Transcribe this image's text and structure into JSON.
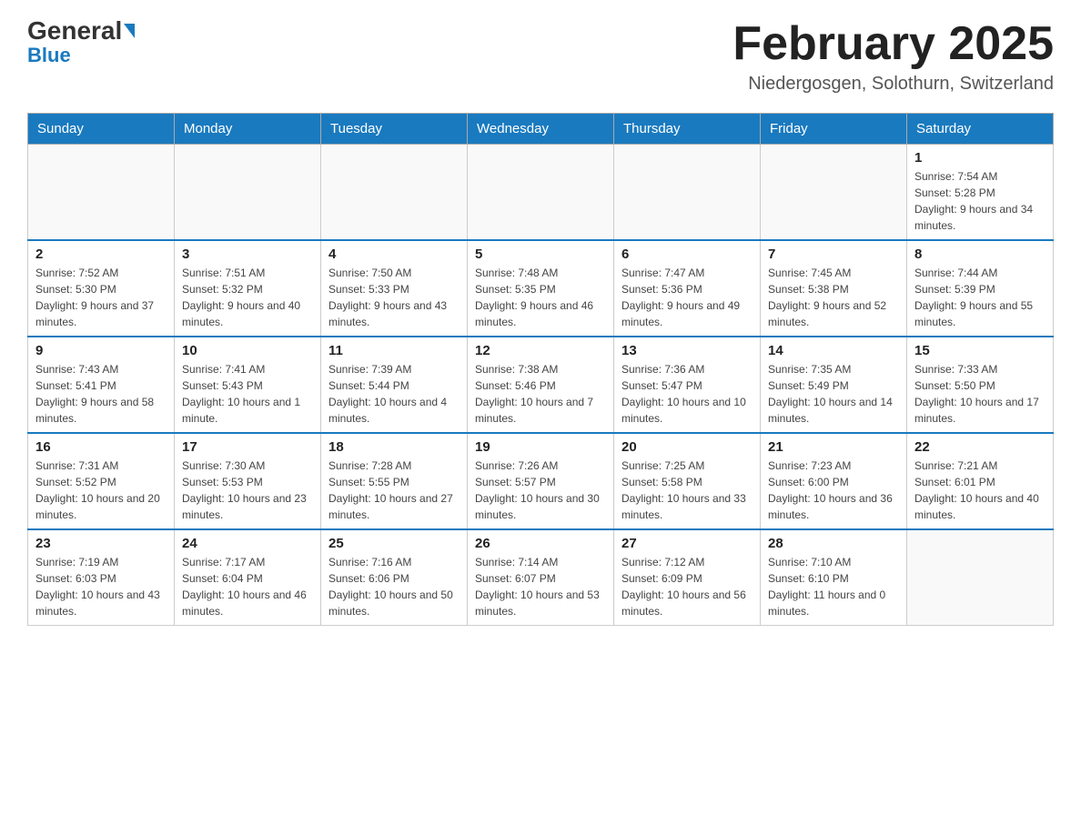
{
  "header": {
    "logo": {
      "general": "General",
      "blue": "Blue",
      "triangle": "▶"
    },
    "title": "February 2025",
    "subtitle": "Niedergosgen, Solothurn, Switzerland"
  },
  "calendar": {
    "days_of_week": [
      "Sunday",
      "Monday",
      "Tuesday",
      "Wednesday",
      "Thursday",
      "Friday",
      "Saturday"
    ],
    "weeks": [
      [
        {
          "day": "",
          "info": ""
        },
        {
          "day": "",
          "info": ""
        },
        {
          "day": "",
          "info": ""
        },
        {
          "day": "",
          "info": ""
        },
        {
          "day": "",
          "info": ""
        },
        {
          "day": "",
          "info": ""
        },
        {
          "day": "1",
          "info": "Sunrise: 7:54 AM\nSunset: 5:28 PM\nDaylight: 9 hours and 34 minutes."
        }
      ],
      [
        {
          "day": "2",
          "info": "Sunrise: 7:52 AM\nSunset: 5:30 PM\nDaylight: 9 hours and 37 minutes."
        },
        {
          "day": "3",
          "info": "Sunrise: 7:51 AM\nSunset: 5:32 PM\nDaylight: 9 hours and 40 minutes."
        },
        {
          "day": "4",
          "info": "Sunrise: 7:50 AM\nSunset: 5:33 PM\nDaylight: 9 hours and 43 minutes."
        },
        {
          "day": "5",
          "info": "Sunrise: 7:48 AM\nSunset: 5:35 PM\nDaylight: 9 hours and 46 minutes."
        },
        {
          "day": "6",
          "info": "Sunrise: 7:47 AM\nSunset: 5:36 PM\nDaylight: 9 hours and 49 minutes."
        },
        {
          "day": "7",
          "info": "Sunrise: 7:45 AM\nSunset: 5:38 PM\nDaylight: 9 hours and 52 minutes."
        },
        {
          "day": "8",
          "info": "Sunrise: 7:44 AM\nSunset: 5:39 PM\nDaylight: 9 hours and 55 minutes."
        }
      ],
      [
        {
          "day": "9",
          "info": "Sunrise: 7:43 AM\nSunset: 5:41 PM\nDaylight: 9 hours and 58 minutes."
        },
        {
          "day": "10",
          "info": "Sunrise: 7:41 AM\nSunset: 5:43 PM\nDaylight: 10 hours and 1 minute."
        },
        {
          "day": "11",
          "info": "Sunrise: 7:39 AM\nSunset: 5:44 PM\nDaylight: 10 hours and 4 minutes."
        },
        {
          "day": "12",
          "info": "Sunrise: 7:38 AM\nSunset: 5:46 PM\nDaylight: 10 hours and 7 minutes."
        },
        {
          "day": "13",
          "info": "Sunrise: 7:36 AM\nSunset: 5:47 PM\nDaylight: 10 hours and 10 minutes."
        },
        {
          "day": "14",
          "info": "Sunrise: 7:35 AM\nSunset: 5:49 PM\nDaylight: 10 hours and 14 minutes."
        },
        {
          "day": "15",
          "info": "Sunrise: 7:33 AM\nSunset: 5:50 PM\nDaylight: 10 hours and 17 minutes."
        }
      ],
      [
        {
          "day": "16",
          "info": "Sunrise: 7:31 AM\nSunset: 5:52 PM\nDaylight: 10 hours and 20 minutes."
        },
        {
          "day": "17",
          "info": "Sunrise: 7:30 AM\nSunset: 5:53 PM\nDaylight: 10 hours and 23 minutes."
        },
        {
          "day": "18",
          "info": "Sunrise: 7:28 AM\nSunset: 5:55 PM\nDaylight: 10 hours and 27 minutes."
        },
        {
          "day": "19",
          "info": "Sunrise: 7:26 AM\nSunset: 5:57 PM\nDaylight: 10 hours and 30 minutes."
        },
        {
          "day": "20",
          "info": "Sunrise: 7:25 AM\nSunset: 5:58 PM\nDaylight: 10 hours and 33 minutes."
        },
        {
          "day": "21",
          "info": "Sunrise: 7:23 AM\nSunset: 6:00 PM\nDaylight: 10 hours and 36 minutes."
        },
        {
          "day": "22",
          "info": "Sunrise: 7:21 AM\nSunset: 6:01 PM\nDaylight: 10 hours and 40 minutes."
        }
      ],
      [
        {
          "day": "23",
          "info": "Sunrise: 7:19 AM\nSunset: 6:03 PM\nDaylight: 10 hours and 43 minutes."
        },
        {
          "day": "24",
          "info": "Sunrise: 7:17 AM\nSunset: 6:04 PM\nDaylight: 10 hours and 46 minutes."
        },
        {
          "day": "25",
          "info": "Sunrise: 7:16 AM\nSunset: 6:06 PM\nDaylight: 10 hours and 50 minutes."
        },
        {
          "day": "26",
          "info": "Sunrise: 7:14 AM\nSunset: 6:07 PM\nDaylight: 10 hours and 53 minutes."
        },
        {
          "day": "27",
          "info": "Sunrise: 7:12 AM\nSunset: 6:09 PM\nDaylight: 10 hours and 56 minutes."
        },
        {
          "day": "28",
          "info": "Sunrise: 7:10 AM\nSunset: 6:10 PM\nDaylight: 11 hours and 0 minutes."
        },
        {
          "day": "",
          "info": ""
        }
      ]
    ]
  }
}
